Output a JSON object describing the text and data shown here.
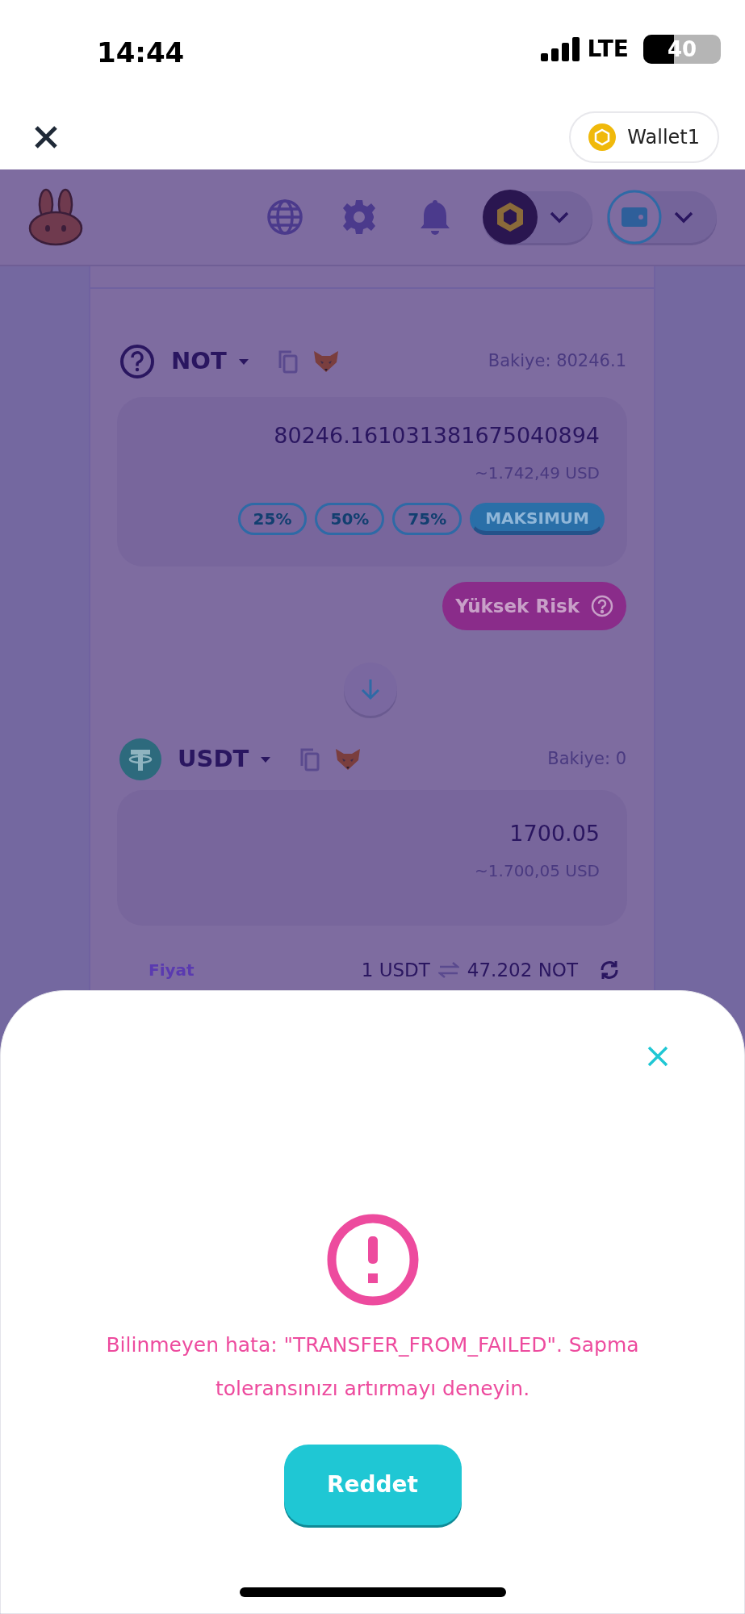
{
  "status_bar": {
    "time": "14:44",
    "network": "LTE",
    "battery": "40"
  },
  "browser_bar": {
    "wallet": "Wallet1"
  },
  "header": {
    "chain_dropdown": {
      "expanded": false
    },
    "wallet_dropdown": {
      "expanded": false
    }
  },
  "swap": {
    "from": {
      "token": "NOT",
      "balance": "Bakiye: 80246.1",
      "amount": "80246.161031381675040894",
      "usd": "~1.742,49 USD",
      "percent_buttons": [
        {
          "label": "25%",
          "selected": false
        },
        {
          "label": "50%",
          "selected": false
        },
        {
          "label": "75%",
          "selected": false
        },
        {
          "label": "MAKSIMUM",
          "selected": true
        }
      ],
      "risk_badge": "Yüksek Risk"
    },
    "to": {
      "token": "USDT",
      "balance": "Bakiye: 0",
      "amount": "1700.05",
      "usd": "~1.700,05 USD"
    },
    "price": {
      "label": "Fiyat",
      "value": "1 USDT",
      "rate": "47.202 NOT"
    }
  },
  "error_modal": {
    "message": "Bilinmeyen hata: \"TRANSFER_FROM_FAILED\". Sapma toleransınızı artırmayı deneyin.",
    "button": "Reddet"
  }
}
